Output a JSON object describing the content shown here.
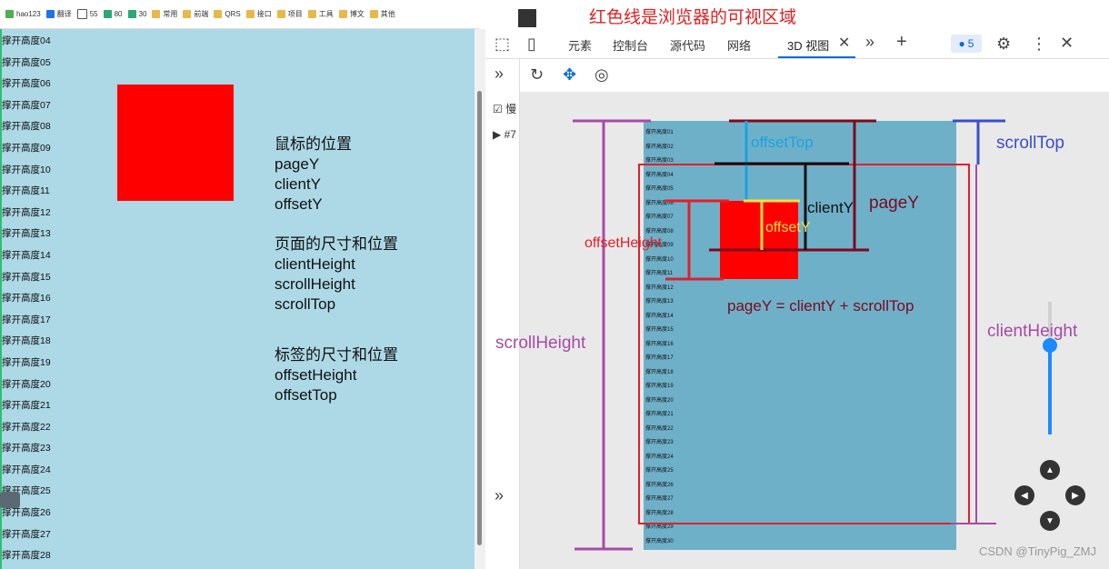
{
  "bookmarks": [
    {
      "label": "hao123",
      "icon": "hao123-icon"
    },
    {
      "label": "翻译",
      "icon": "translate-icon"
    },
    {
      "label": "55",
      "icon": "page-icon"
    },
    {
      "label": "80",
      "icon": "vue-icon"
    },
    {
      "label": "30",
      "icon": "vue-icon"
    },
    {
      "label": "常用",
      "icon": "folder-icon"
    },
    {
      "label": "前端",
      "icon": "folder-icon"
    },
    {
      "label": "QRS",
      "icon": "folder-icon"
    },
    {
      "label": "接口",
      "icon": "folder-icon"
    },
    {
      "label": "项目",
      "icon": "folder-icon"
    },
    {
      "label": "工具",
      "icon": "folder-icon"
    },
    {
      "label": "博文",
      "icon": "folder-icon"
    },
    {
      "label": "其他",
      "icon": "folder-icon"
    }
  ],
  "left_rows": [
    "撑开高度04",
    "撑开高度05",
    "撑开高度06",
    "撑开高度07",
    "撑开高度08",
    "撑开高度09",
    "撑开高度10",
    "撑开高度11",
    "撑开高度12",
    "撑开高度13",
    "撑开高度14",
    "撑开高度15",
    "撑开高度16",
    "撑开高度17",
    "撑开高度18",
    "撑开高度19",
    "撑开高度20",
    "撑开高度21",
    "撑开高度22",
    "撑开高度23",
    "撑开高度24",
    "撑开高度25",
    "撑开高度26",
    "撑开高度27",
    "撑开高度28"
  ],
  "notes": {
    "mouse_title": "鼠标的位置",
    "mouse_1": "pageY",
    "mouse_2": "clientY",
    "mouse_3": "offsetY",
    "page_title": "页面的尺寸和位置",
    "page_1": "clientHeight",
    "page_2": "scrollHeight",
    "page_3": "scrollTop",
    "tag_title": "标签的尺寸和位置",
    "tag_1": "offsetHeight",
    "tag_2": "offsetTop"
  },
  "annotation_title": "红色线是浏览器的可视区域",
  "tabs": [
    "元素",
    "控制台",
    "源代码",
    "网络",
    "3D 视图"
  ],
  "badge_count": "5",
  "side_text": {
    "checkbox_label": "慢",
    "item": "#7"
  },
  "mini_rows": [
    "撑开高度01",
    "撑开高度02",
    "撑开高度03",
    "撑开高度04",
    "撑开高度05",
    "撑开高度06",
    "撑开高度07",
    "撑开高度08",
    "撑开高度09",
    "撑开高度10",
    "撑开高度11",
    "撑开高度12",
    "撑开高度13",
    "撑开高度14",
    "撑开高度15",
    "撑开高度16",
    "撑开高度17",
    "撑开高度18",
    "撑开高度19",
    "撑开高度20",
    "撑开高度21",
    "撑开高度22",
    "撑开高度23",
    "撑开高度24",
    "撑开高度25",
    "撑开高度26",
    "撑开高度27",
    "撑开高度28",
    "撑开高度29",
    "撑开高度30"
  ],
  "labels": {
    "offsetTop": "offsetTop",
    "scrollTop": "scrollTop",
    "clientY": "clientY",
    "pageY": "pageY",
    "offsetY": "offsetY",
    "offsetHeight": "offsetHeight",
    "formula": "pageY = clientY + scrollTop",
    "scrollHeight": "scrollHeight",
    "clientHeight": "clientHeight"
  },
  "watermark": "CSDN @TinyPig_ZMJ",
  "colors": {
    "light_blue": "#add8e6",
    "red": "#ff0000",
    "accent": "#0a6cd6"
  }
}
